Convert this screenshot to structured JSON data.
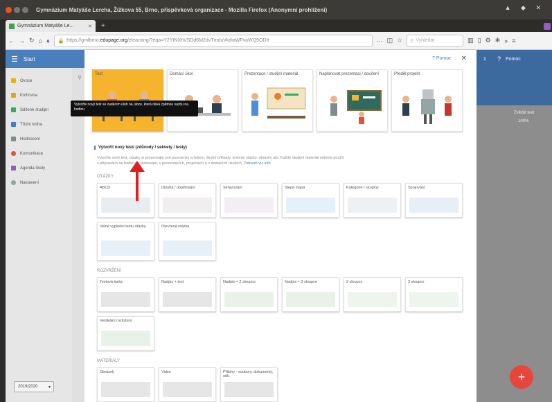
{
  "window": {
    "title": "Gymnázium Matyáše Lercha, Žižkova 55, Brno, příspěvková organizace - Mozilla Firefox (Anonymní prohlížení)"
  },
  "tabs": [
    {
      "label": "Gymnázium Matyáše Le..."
    }
  ],
  "navbar": {
    "url_prefix": "https://gmlbrno.",
    "url_domain": "edupage.org",
    "url_rest": "/elearning/?eqa=Y2YtNXhVSDd6M2dvTmduVkdiaWFvaWQ9ODIt",
    "more": "···",
    "search_placeholder": "Vyhledat"
  },
  "app": {
    "menu_label": "Start",
    "sidebar": [
      {
        "label": "Ovoce",
        "color": "#f0b400"
      },
      {
        "label": "Knihovna",
        "color": "#f39c12"
      },
      {
        "label": "Sdílené studijní",
        "color": "#27ae60"
      },
      {
        "label": "Třídní kniha",
        "color": "#3b7dd8"
      },
      {
        "label": "Hodnocení",
        "color": "#7f8c8d"
      },
      {
        "label": "Komunikace",
        "color": "#e74c3c"
      },
      {
        "label": "Agenda školy",
        "color": "#9b59b6"
      },
      {
        "label": "Nastavení",
        "color": "#95a5a6"
      }
    ],
    "school_year": "2019/2020"
  },
  "right_panel": {
    "count": "1",
    "help": "Pomoc",
    "zoom_label": "Zvětšit text",
    "zoom_value": "100%"
  },
  "dialog": {
    "help": "Pomoc",
    "tooltip": "Vytvořte nový test se zadáním úloh na úloze, která dává zpětnou vazbu na hodinu",
    "categories": [
      {
        "label": "Test",
        "selected": true
      },
      {
        "label": "Domácí úkol",
        "selected": false
      },
      {
        "label": "Prezentace / studijní materiál",
        "selected": false
      },
      {
        "label": "Naplánovat prezentaci / doučení",
        "selected": false
      },
      {
        "label": "Předěl projekt",
        "selected": false
      }
    ],
    "section_title": "Vytvořit nový test/ (zdůvody / sekvety / testy)",
    "description": "Vytvořte nový test, otázky si prezentujte své poznámky a řešení, školní příklady, textové otázky, obrázky atd. Každý studijní materiál můžete použít v připravách na hodinu, v plánování, v prezentacích, projektech a v domácích úkolech.",
    "description_link": "Zobrazit víc info",
    "groups": [
      {
        "label": "OTÁZKY",
        "items": [
          "ABCD",
          "Dlouhá / doplňování",
          "Seřazování",
          "Slepá mapa",
          "Kategorie / skupiny",
          "Spojování",
          "Volné vyplnění textu otázky",
          "Otevřená otázka"
        ]
      },
      {
        "label": "ROZVRŽENÍ",
        "items": [
          "Textová karta",
          "Nadpis + text",
          "Nadpis + 2 sloupce",
          "Nadpis + 3 sloupce",
          "2 sloupce",
          "3 sloupce",
          "Vertikální rozložení"
        ]
      },
      {
        "label": "MATERIÁLY",
        "items": [
          "Obrázek",
          "Video",
          "Přílohy - soubory, dokumenty, odk."
        ]
      }
    ]
  },
  "fab": "+"
}
